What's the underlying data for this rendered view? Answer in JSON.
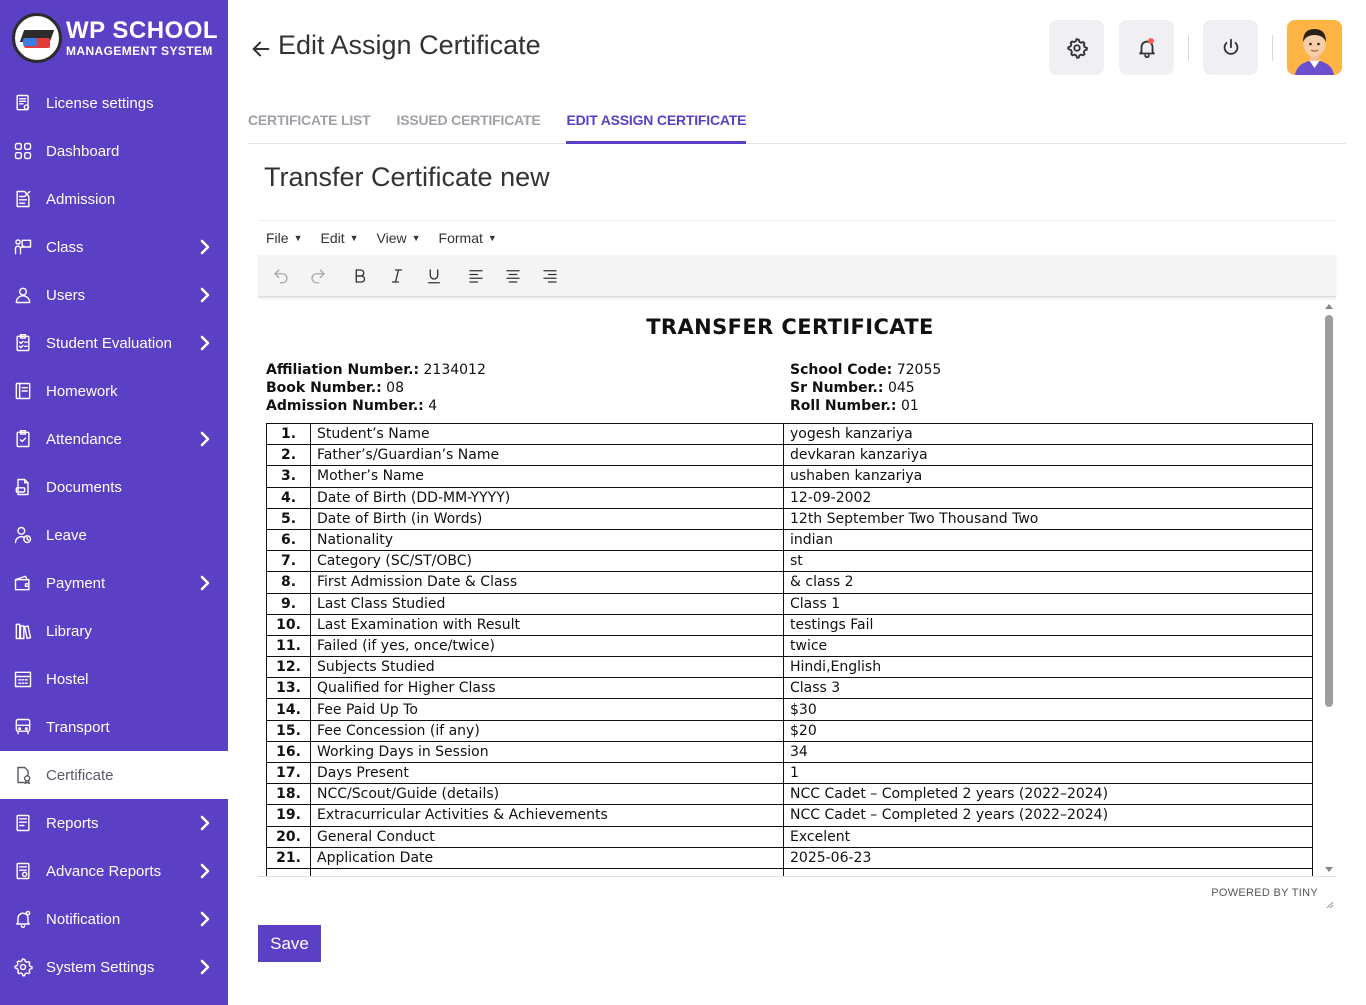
{
  "brand": {
    "title": "WP SCHOOL",
    "subtitle": "MANAGEMENT SYSTEM"
  },
  "sidebar": {
    "items": [
      {
        "label": "License settings",
        "icon": "license-icon",
        "has_children": false,
        "active": false
      },
      {
        "label": "Dashboard",
        "icon": "dashboard-icon",
        "has_children": false,
        "active": false
      },
      {
        "label": "Admission",
        "icon": "admission-icon",
        "has_children": false,
        "active": false
      },
      {
        "label": "Class",
        "icon": "class-icon",
        "has_children": true,
        "active": false
      },
      {
        "label": "Users",
        "icon": "user-icon",
        "has_children": true,
        "active": false
      },
      {
        "label": "Student Evaluation",
        "icon": "evaluation-icon",
        "has_children": true,
        "active": false
      },
      {
        "label": "Homework",
        "icon": "homework-icon",
        "has_children": false,
        "active": false
      },
      {
        "label": "Attendance",
        "icon": "attendance-icon",
        "has_children": true,
        "active": false
      },
      {
        "label": "Documents",
        "icon": "documents-icon",
        "has_children": false,
        "active": false
      },
      {
        "label": "Leave",
        "icon": "leave-icon",
        "has_children": false,
        "active": false
      },
      {
        "label": "Payment",
        "icon": "wallet-icon",
        "has_children": true,
        "active": false
      },
      {
        "label": "Library",
        "icon": "library-icon",
        "has_children": false,
        "active": false
      },
      {
        "label": "Hostel",
        "icon": "hostel-icon",
        "has_children": false,
        "active": false
      },
      {
        "label": "Transport",
        "icon": "bus-icon",
        "has_children": false,
        "active": false
      },
      {
        "label": "Certificate",
        "icon": "certificate-icon",
        "has_children": false,
        "active": true
      },
      {
        "label": "Reports",
        "icon": "reports-icon",
        "has_children": true,
        "active": false
      },
      {
        "label": "Advance Reports",
        "icon": "advance-reports-icon",
        "has_children": true,
        "active": false
      },
      {
        "label": "Notification",
        "icon": "notification-icon",
        "has_children": true,
        "active": false
      },
      {
        "label": "System Settings",
        "icon": "settings-icon",
        "has_children": true,
        "active": false
      }
    ]
  },
  "header": {
    "title": "Edit Assign Certificate"
  },
  "tabs": [
    {
      "label": "CERTIFICATE LIST",
      "active": false
    },
    {
      "label": "ISSUED CERTIFICATE",
      "active": false
    },
    {
      "label": "EDIT ASSIGN CERTIFICATE",
      "active": true
    }
  ],
  "certificate_name": "Transfer Certificate new",
  "editor": {
    "menus": [
      "File",
      "Edit",
      "View",
      "Format"
    ],
    "powered_by": "POWERED BY TINY"
  },
  "document": {
    "heading": "TRANSFER CERTIFICATE",
    "left_meta": [
      {
        "label": "Affiliation Number.:",
        "value": "2134012"
      },
      {
        "label": "Book Number.:",
        "value": "08"
      },
      {
        "label": "Admission Number.:",
        "value": "4"
      }
    ],
    "right_meta": [
      {
        "label": "School Code:",
        "value": "72055"
      },
      {
        "label": "Sr Number.:",
        "value": "045"
      },
      {
        "label": "Roll Number.:",
        "value": "01"
      }
    ],
    "rows": [
      {
        "num": "1.",
        "field": "Student’s Name",
        "value": "yogesh kanzariya"
      },
      {
        "num": "2.",
        "field": "Father’s/Guardian’s Name",
        "value": "devkaran kanzariya"
      },
      {
        "num": "3.",
        "field": "Mother’s Name",
        "value": "ushaben kanzariya"
      },
      {
        "num": "4.",
        "field": "Date of Birth (DD-MM-YYYY)",
        "value": "12-09-2002"
      },
      {
        "num": "5.",
        "field": "Date of Birth (in Words)",
        "value": "12th September Two Thousand Two"
      },
      {
        "num": "6.",
        "field": "Nationality",
        "value": "indian"
      },
      {
        "num": "7.",
        "field": "Category (SC/ST/OBC)",
        "value": "st"
      },
      {
        "num": "8.",
        "field": "First Admission Date & Class",
        "value": "& class 2"
      },
      {
        "num": "9.",
        "field": "Last Class Studied",
        "value": "Class 1"
      },
      {
        "num": "10.",
        "field": "Last Examination with Result",
        "value": "testings Fail"
      },
      {
        "num": "11.",
        "field": "Failed (if yes, once/twice)",
        "value": "twice"
      },
      {
        "num": "12.",
        "field": "Subjects Studied",
        "value": "Hindi,English"
      },
      {
        "num": "13.",
        "field": "Qualified for Higher Class",
        "value": "Class 3"
      },
      {
        "num": "14.",
        "field": "Fee Paid Up To",
        "value": "$30"
      },
      {
        "num": "15.",
        "field": "Fee Concession (if any)",
        "value": "$20"
      },
      {
        "num": "16.",
        "field": "Working Days in Session",
        "value": "34"
      },
      {
        "num": "17.",
        "field": "Days Present",
        "value": "1"
      },
      {
        "num": "18.",
        "field": "NCC/Scout/Guide (details)",
        "value": "NCC Cadet – Completed 2 years (2022–2024)"
      },
      {
        "num": "19.",
        "field": "Extracurricular Activities & Achievements",
        "value": "NCC Cadet – Completed 2 years (2022–2024)"
      },
      {
        "num": "20.",
        "field": "General Conduct",
        "value": "Excelent"
      },
      {
        "num": "21.",
        "field": "Application Date",
        "value": "2025-06-23"
      },
      {
        "num": "",
        "field": "",
        "value": ""
      }
    ]
  },
  "save_label": "Save",
  "colors": {
    "primary": "#5b3fc4",
    "active_tab": "#5b3fc4",
    "notification_dot": "#ff5a5a",
    "avatar_bg": "#ffb545"
  }
}
